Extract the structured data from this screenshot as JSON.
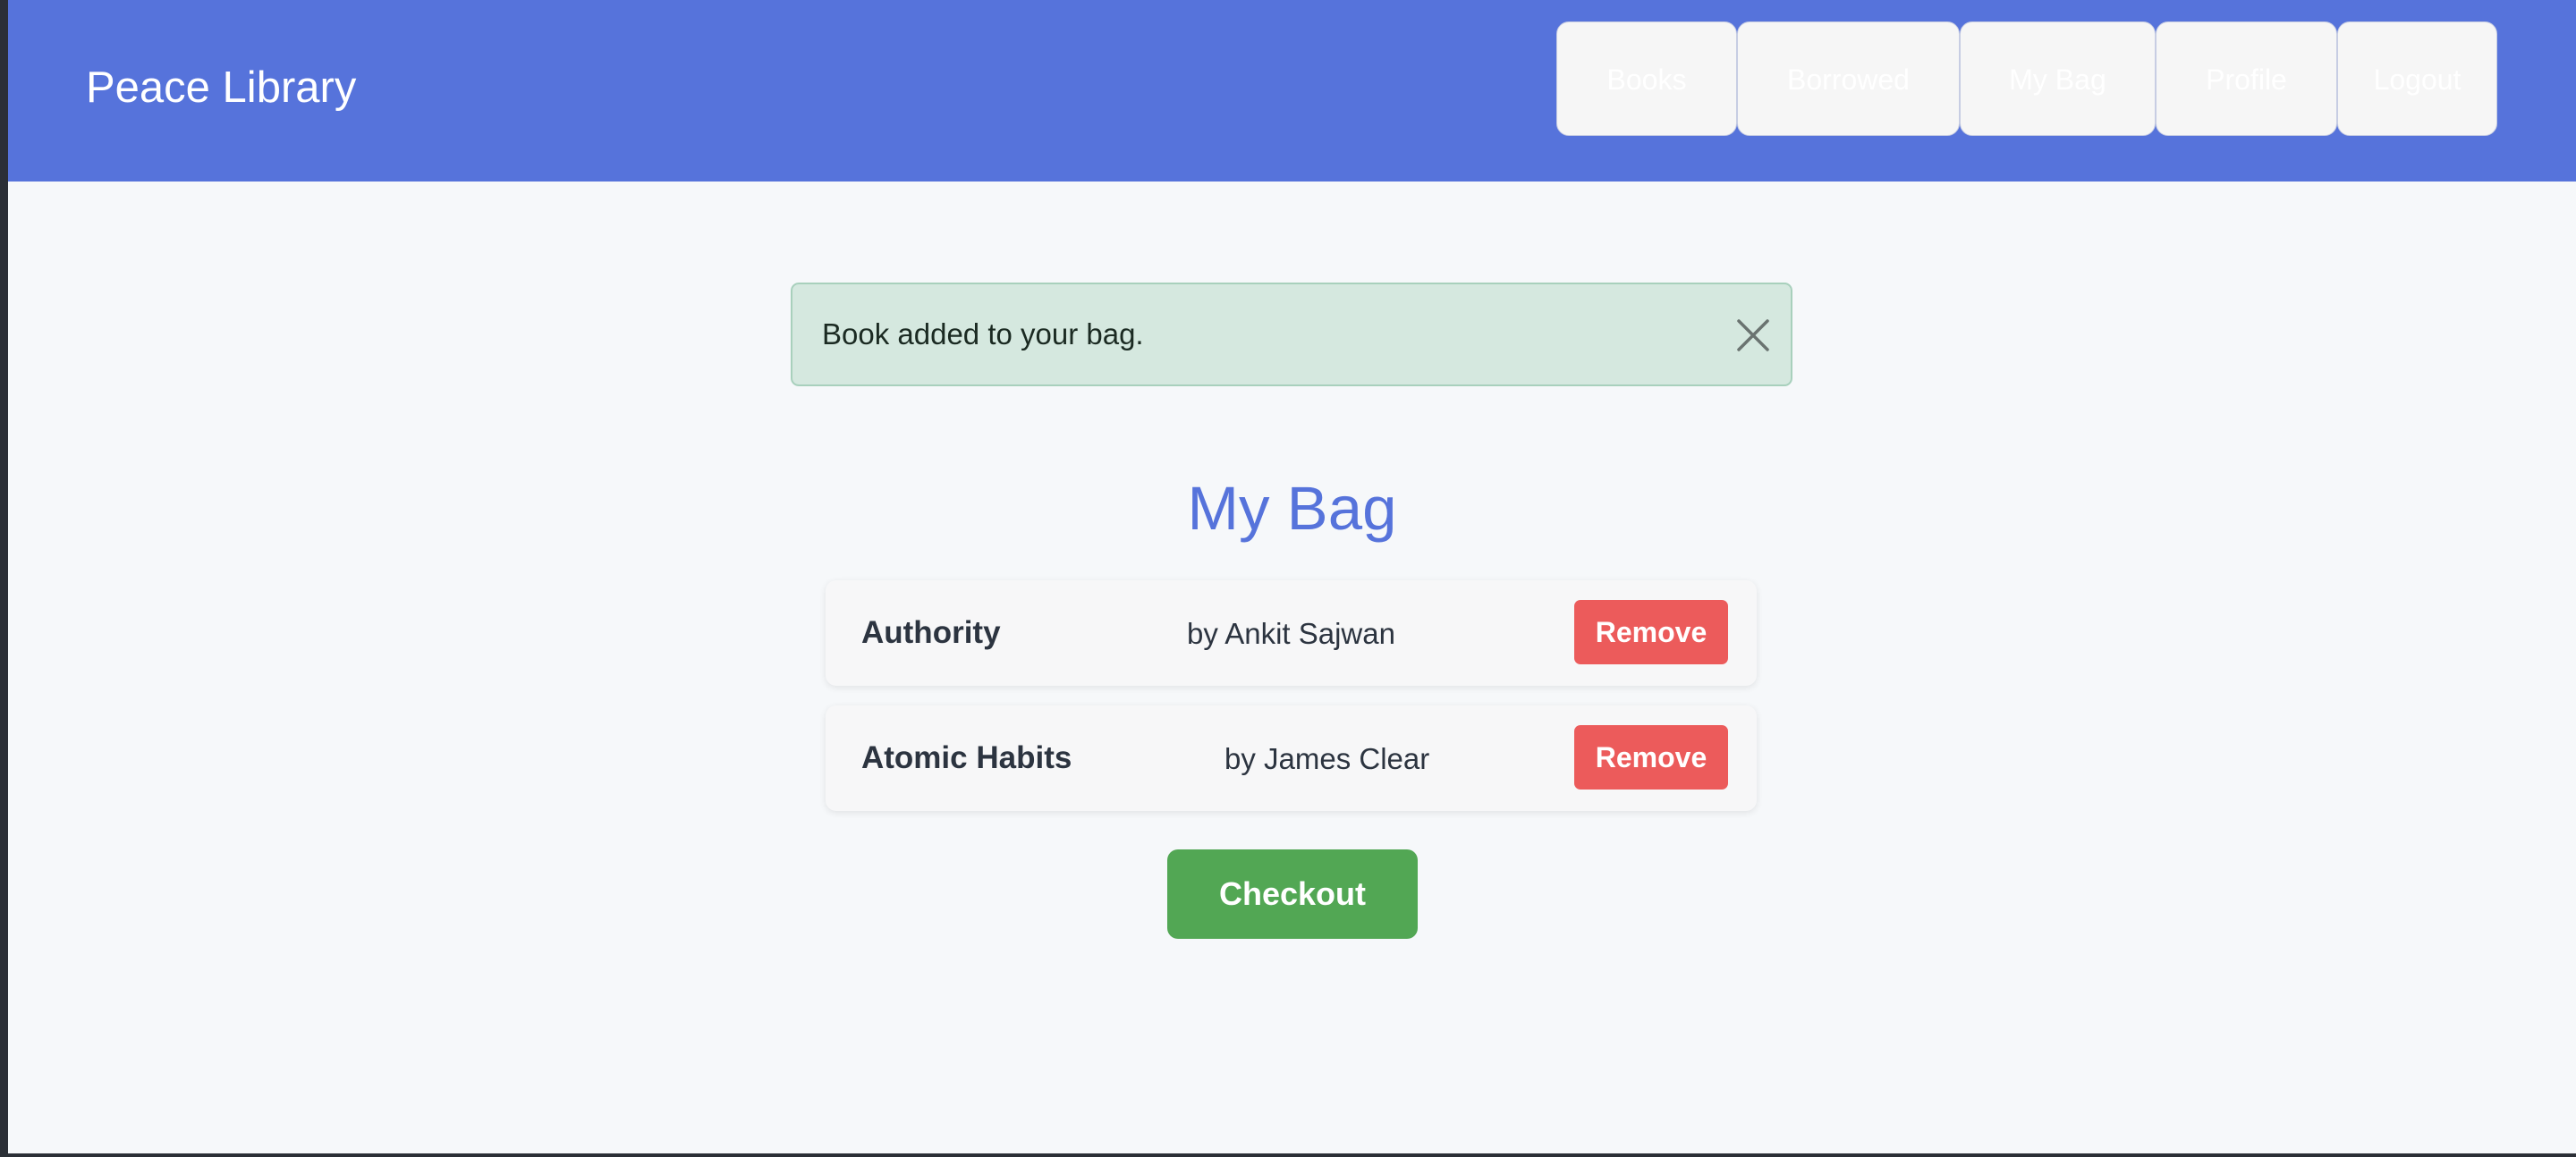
{
  "app": {
    "brand": "Peace Library"
  },
  "nav": {
    "items": [
      {
        "label": "Books"
      },
      {
        "label": "Borrowed"
      },
      {
        "label": "My Bag"
      },
      {
        "label": "Profile"
      },
      {
        "label": "Logout"
      }
    ]
  },
  "alert": {
    "message": "Book added to your bag.",
    "close_icon": "close-icon"
  },
  "main": {
    "title": "My Bag",
    "items": [
      {
        "title": "Authority",
        "author": "by Ankit Sajwan",
        "remove_label": "Remove"
      },
      {
        "title": "Atomic Habits",
        "author": "by James Clear",
        "remove_label": "Remove"
      }
    ],
    "checkout_label": "Checkout"
  },
  "colors": {
    "navbar": "#5673db",
    "title": "#5673db",
    "alert_background": "#d5e8df",
    "remove_button": "#ec5b5b",
    "checkout_button": "#52a754",
    "page_background": "#f6f8fa"
  }
}
